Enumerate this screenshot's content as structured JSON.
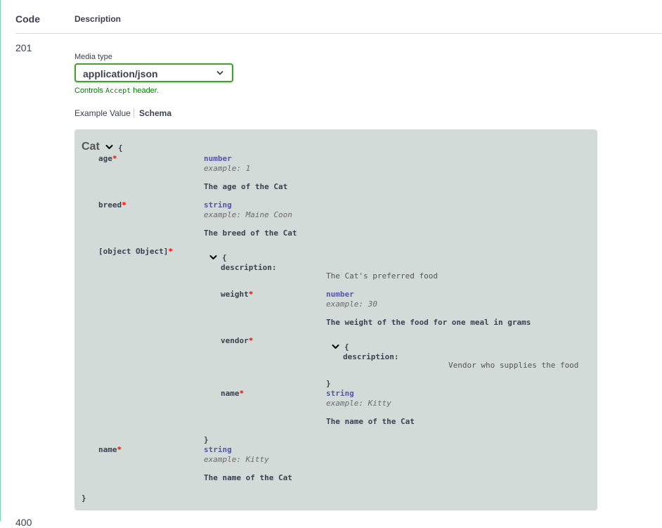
{
  "header": {
    "code": "Code",
    "description": "Description"
  },
  "response": {
    "code": "201",
    "next_code_partial": "400"
  },
  "media_type": {
    "label": "Media type",
    "selected": "application/json",
    "help_prefix": "Controls ",
    "help_code": "Accept",
    "help_suffix": " header."
  },
  "tabs": {
    "example": "Example Value",
    "schema": "Schema"
  },
  "schema": {
    "title": "Cat",
    "open_brace": "{",
    "close_brace": "}",
    "required_mark": "*",
    "props": {
      "age": {
        "name": "age",
        "type": "number",
        "example": "example: 1",
        "description": "The age of the Cat"
      },
      "breed": {
        "name": "breed",
        "type": "string",
        "example": "example: Maine Coon",
        "description": "The breed of the Cat"
      },
      "preferredFood": {
        "name": {
          "name": "name",
          "type": "string",
          "example": "example: Kitty",
          "description": "The name of the Cat"
        },
        "description_label": "description:",
        "description": "The Cat's preferred food",
        "weight": {
          "name": "weight",
          "type": "number",
          "example": "example: 30",
          "description": "The weight of the food for one meal in grams"
        },
        "vendor": {
          "name": "vendor",
          "description_label": "description:",
          "description": "Vendor who supplies the food"
        }
      },
      "name": {
        "name": "name",
        "type": "string",
        "example": "example: Kitty",
        "description": "The name of the Cat"
      }
    }
  },
  "colors": {
    "accent_green": "#49cc90",
    "select_border": "#41a32d",
    "help_text": "#008000",
    "required": "#ff0000",
    "type_text": "#5555aa",
    "schema_bg": "#d3dbd8"
  },
  "icons": {
    "select_chevron": "chevron-down-icon",
    "expand_chevron": "chevron-down-icon"
  }
}
